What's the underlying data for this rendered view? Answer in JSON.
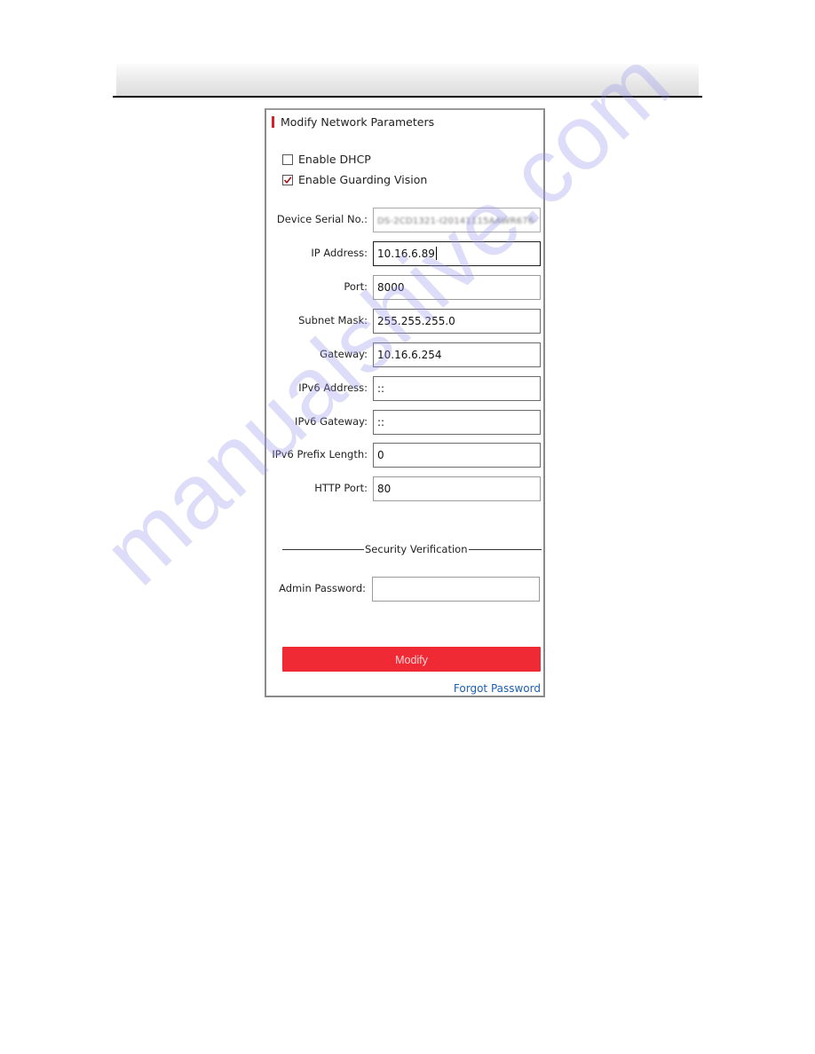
{
  "panel": {
    "title": "Modify Network Parameters",
    "accent_color": "#d6202a"
  },
  "options": [
    {
      "label": "Enable DHCP",
      "checked": false
    },
    {
      "label": "Enable Guarding Vision",
      "checked": true
    }
  ],
  "fields": [
    {
      "label": "Device Serial No.:",
      "value": "DS-2CD1321-I20141115AAWR676-",
      "state": "readonly-blurred"
    },
    {
      "label": "IP Address:",
      "value": "10.16.6.89",
      "state": "focused"
    },
    {
      "label": "Port:",
      "value": "8000",
      "state": "normal"
    },
    {
      "label": "Subnet Mask:",
      "value": "255.255.255.0",
      "state": "normal"
    },
    {
      "label": "Gateway:",
      "value": "10.16.6.254",
      "state": "normal"
    },
    {
      "label": "IPv6 Address:",
      "value": "::",
      "state": "normal"
    },
    {
      "label": "IPv6 Gateway:",
      "value": "::",
      "state": "normal"
    },
    {
      "label": "IPv6 Prefix Length:",
      "value": "0",
      "state": "normal"
    },
    {
      "label": "HTTP Port:",
      "value": "80",
      "state": "normal"
    }
  ],
  "security": {
    "section_title": "Security Verification",
    "password_label": "Admin Password:",
    "password_value": ""
  },
  "actions": {
    "modify_label": "Modify",
    "modify_color": "#ef2a35",
    "forgot_label": "Forgot Password",
    "link_color": "#1f5fb0"
  },
  "watermark": {
    "text": "manualshive.com"
  }
}
